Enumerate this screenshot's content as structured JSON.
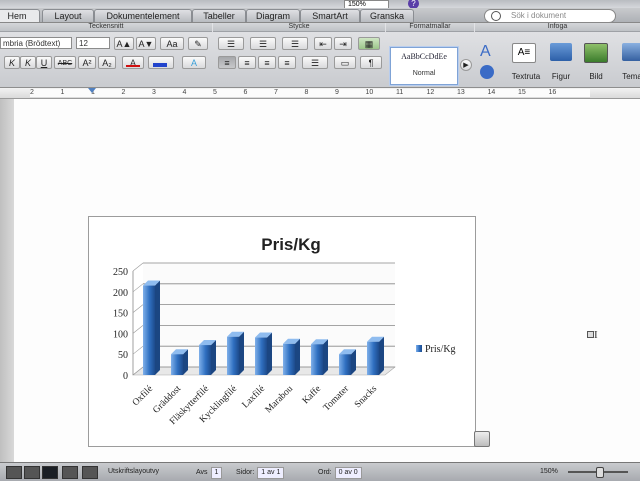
{
  "toolbar": {
    "zoom": "150%",
    "help": "?"
  },
  "tabs": [
    {
      "label": "Hem"
    },
    {
      "label": "Layout"
    },
    {
      "label": "Dokumentelement"
    },
    {
      "label": "Tabeller"
    },
    {
      "label": "Diagram"
    },
    {
      "label": "SmartArt"
    },
    {
      "label": "Granska"
    }
  ],
  "search": {
    "placeholder": "Sök i dokument"
  },
  "ribbon": {
    "groups": [
      "Teckensnitt",
      "Stycke",
      "Formatmallar",
      "Infoga"
    ],
    "font_name": "mbria (Brödtext)",
    "font_size": "12",
    "font_buttons": [
      "A▲",
      "A▼",
      "Aa",
      "✎"
    ],
    "format_buttons": [
      "K",
      "K",
      "U",
      "ABC",
      "A²",
      "A₂"
    ],
    "style_sample": "AaBbCcDdEe",
    "style_name": "Normal",
    "insert_items": [
      "Textruta",
      "Figur",
      "Bild",
      "Tema"
    ]
  },
  "ruler": {
    "numbers": [
      "2",
      "1",
      "1",
      "2",
      "3",
      "4",
      "5",
      "6",
      "7",
      "8",
      "9",
      "10",
      "11",
      "12",
      "13",
      "14",
      "15",
      "16"
    ]
  },
  "chart_data": {
    "type": "bar",
    "title": "Pris/Kg",
    "categories": [
      "Oxfilé",
      "Gräddost",
      "Fläskytterfilé",
      "Kycklingfilé",
      "Laxfilé",
      "Marabou",
      "Kaffe",
      "Tomater",
      "Snacks"
    ],
    "series": [
      {
        "name": "Pris/Kg",
        "values": [
          215,
          50,
          72,
          92,
          90,
          75,
          74,
          50,
          80
        ]
      }
    ],
    "ylim": [
      0,
      250
    ],
    "yticks": [
      "0",
      "50",
      "100",
      "150",
      "200",
      "250"
    ],
    "grid": true,
    "legend": "right",
    "color": "#2f6fc0"
  },
  "status": {
    "view_label": "Utskriftslayoutvy",
    "avs_label": "Avs",
    "avs_value": "1",
    "sidor_label": "Sidor:",
    "sidor_value": "1 av 1",
    "ord_label": "Ord:",
    "ord_value": "0 av 0",
    "zoom": "150%"
  }
}
